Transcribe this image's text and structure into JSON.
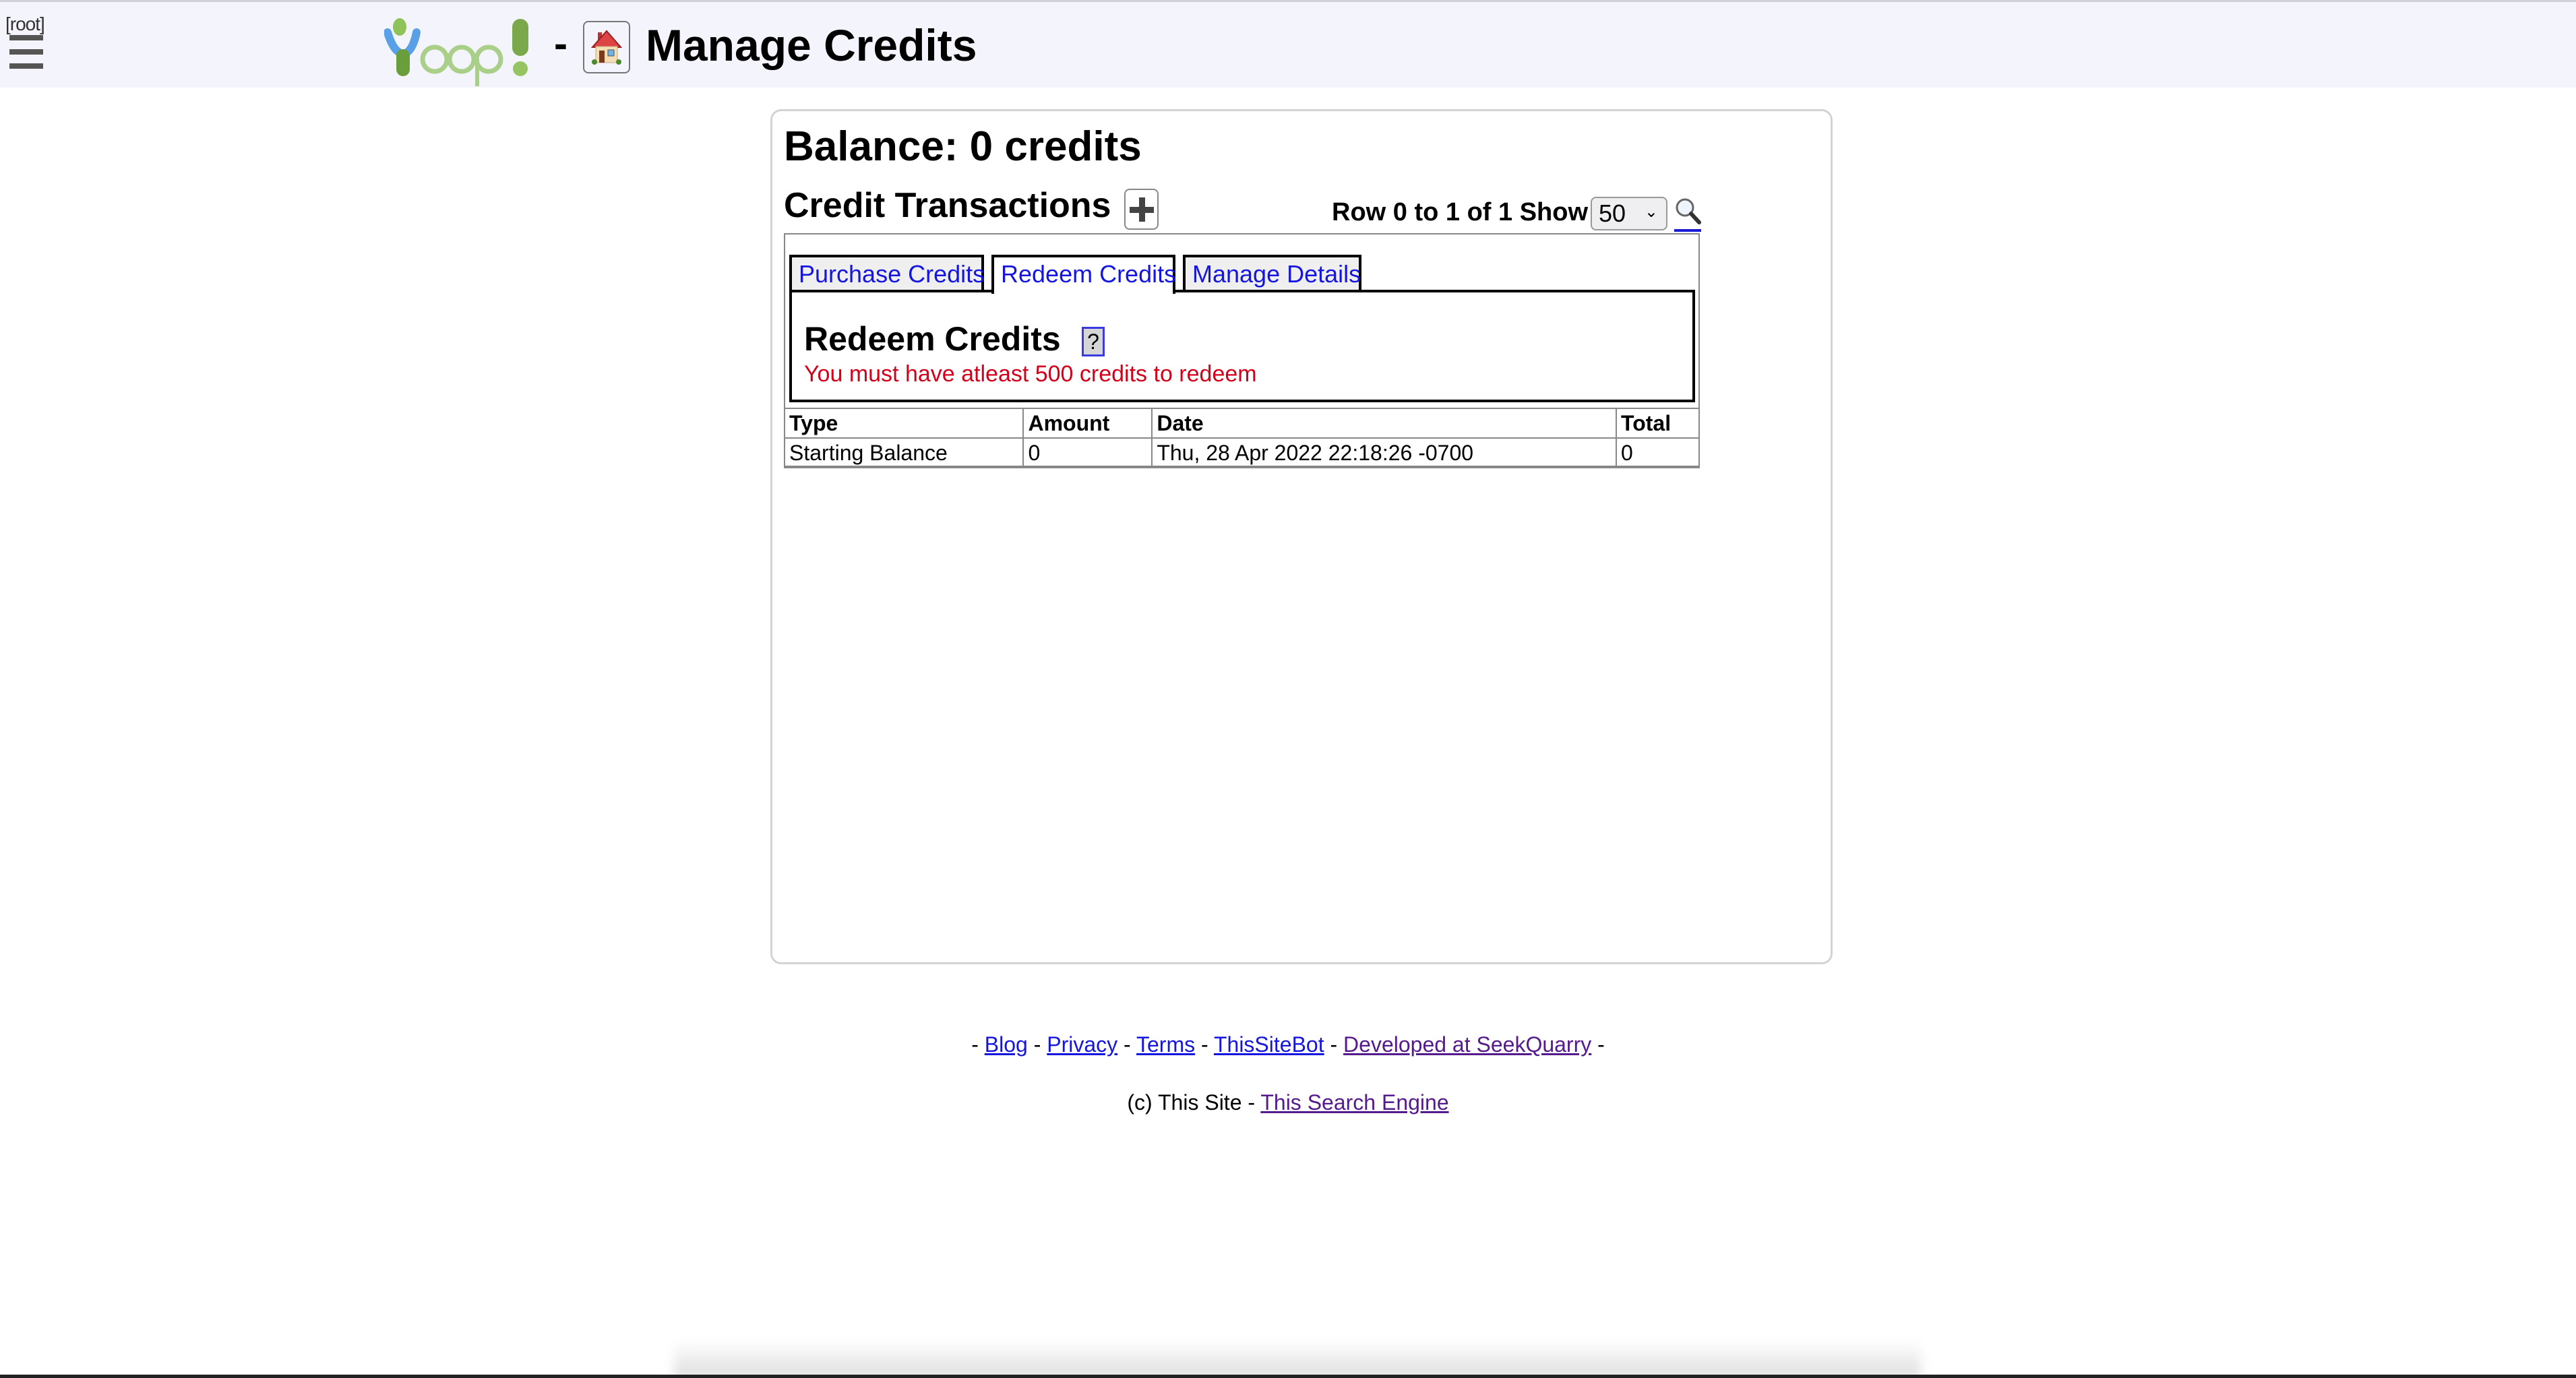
{
  "header": {
    "user_label": "[root]",
    "logo_text": "Yoopi!",
    "separator": "-",
    "title": "Manage Credits"
  },
  "main": {
    "balance": "Balance: 0 credits",
    "transactions_title": "Credit Transactions",
    "pager_text": "Row 0 to 1 of 1 Show",
    "show_select_value": "50",
    "tabs": [
      {
        "label": "Purchase Credits",
        "active": false
      },
      {
        "label": "Redeem Credits",
        "active": true
      },
      {
        "label": "Manage Details",
        "active": false
      }
    ],
    "panel": {
      "title": "Redeem Credits",
      "help_label": "?",
      "error_message": "You must have atleast 500 credits to redeem",
      "error_color": "#d4001a"
    },
    "table": {
      "columns": [
        "Type",
        "Amount",
        "Date",
        "Total"
      ],
      "rows": [
        [
          "Starting Balance",
          "0",
          "Thu, 28 Apr 2022 22:18:26 -0700",
          "0"
        ]
      ]
    }
  },
  "footer": {
    "links": [
      "Blog",
      "Privacy",
      "Terms",
      "ThisSiteBot",
      "Developed at SeekQuarry"
    ],
    "copyright_prefix": "(c) This Site -",
    "engine_link": "This Search Engine"
  },
  "icons": {
    "menu": "hamburger-icon",
    "home": "home-icon",
    "add": "plus-icon",
    "search": "magnifier-icon"
  }
}
